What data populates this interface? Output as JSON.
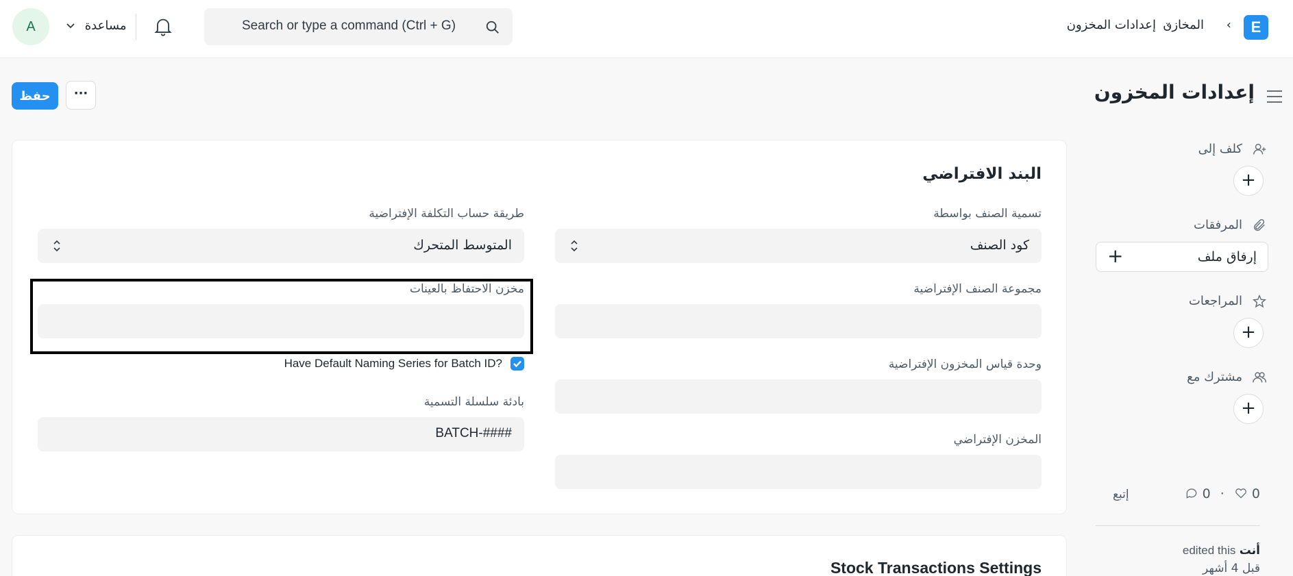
{
  "navbar": {
    "logo_letter": "E",
    "breadcrumb": [
      "المخازن",
      "إعدادات المخزون"
    ],
    "breadcrumb_sep": "›",
    "search_placeholder": "Search or type a command (Ctrl + G)",
    "help_label": "مساعدة",
    "avatar_letter": "A"
  },
  "page": {
    "title": "إعدادات المخزون",
    "save_label": "حفظ",
    "more_label": "···"
  },
  "sidebar": {
    "assign_label": "كلف إلى",
    "attachments_label": "المرفقات",
    "attach_file_label": "إرفاق ملف",
    "reviews_label": "المراجعات",
    "shared_label": "مشترك مع",
    "likes_count": "0",
    "comments_count": "0",
    "follow_label": "إتبع",
    "activity_user": "أنت",
    "activity_text": "edited this",
    "activity_time": "قبل 4 أشهر"
  },
  "section": {
    "title": "البند الافتراضي",
    "fields": {
      "item_naming_by": {
        "label": "تسمية الصنف بواسطة",
        "value": "كود الصنف"
      },
      "valuation_method": {
        "label": "طريقة حساب التكلفة الإفتراضية",
        "value": "المتوسط المتحرك"
      },
      "default_item_group": {
        "label": "مجموعة الصنف الإفتراضية",
        "value": ""
      },
      "sample_retention_warehouse": {
        "label": "مخزن الاحتفاظ بالعينات",
        "value": ""
      },
      "default_stock_uom": {
        "label": "وحدة قياس المخزون الإفتراضية",
        "value": ""
      },
      "batch_naming": {
        "label": "Have Default Naming Series for Batch ID?",
        "checked": true
      },
      "default_warehouse": {
        "label": "المخزن الإفتراضي",
        "value": ""
      },
      "naming_series_prefix": {
        "label": "بادئة سلسلة التسمية",
        "value": "BATCH-####"
      }
    }
  },
  "section2": {
    "title": "Stock Transactions Settings"
  },
  "colors": {
    "primary": "#2490ef",
    "input_bg": "#f3f3f3",
    "page_bg": "#f8f8f8"
  }
}
